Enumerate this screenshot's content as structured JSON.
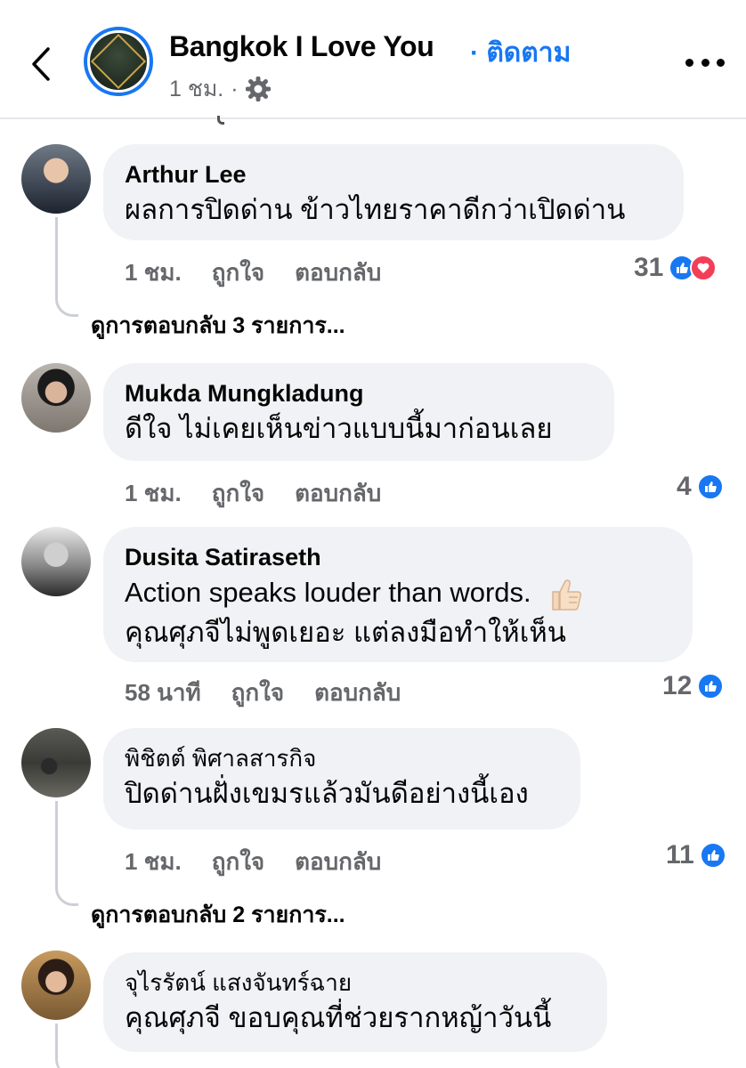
{
  "header": {
    "page_name": "Bangkok I Love You",
    "follow_label": "· ติดตาม",
    "time": "1 ชม.",
    "dot": "·"
  },
  "comments": [
    {
      "author": "Arthur Lee",
      "lines": [
        "ผลการปิดด่าน ข้าวไทยราคาดีกว่าเปิดด่าน"
      ],
      "time": "1 ชม.",
      "like": "ถูกใจ",
      "reply": "ตอบกลับ",
      "reaction_count": "31",
      "reactions": [
        "like",
        "love"
      ],
      "view_replies": "ดูการตอบกลับ 3 รายการ..."
    },
    {
      "author": "Mukda Mungkladung",
      "lines": [
        "ดีใจ  ไม่เคยเห็นข่าวแบบนี้มาก่อนเลย"
      ],
      "time": "1 ชม.",
      "like": "ถูกใจ",
      "reply": "ตอบกลับ",
      "reaction_count": "4",
      "reactions": [
        "like"
      ]
    },
    {
      "author": "Dusita Satiraseth",
      "lines": [
        "Action speaks louder than words.",
        "คุณศุภจีไม่พูดเยอะ แต่ลงมือทำให้เห็น"
      ],
      "time": "58 นาที",
      "like": "ถูกใจ",
      "reply": "ตอบกลับ",
      "reaction_count": "12",
      "reactions": [
        "like"
      ]
    },
    {
      "author": "พิชิตต์ พิศาลสารกิจ",
      "lines": [
        "ปิดด่านฝั่งเขมรแล้วมันดีอย่างนี้เอง"
      ],
      "time": "1 ชม.",
      "like": "ถูกใจ",
      "reply": "ตอบกลับ",
      "reaction_count": "11",
      "reactions": [
        "like"
      ],
      "view_replies": "ดูการตอบกลับ 2 รายการ..."
    },
    {
      "author": "จุไรรัตน์ แสงจันทร์ฉาย",
      "lines": [
        "คุณศุภจี  ขอบคุณที่ช่วยรากหญ้าวันนี้"
      ]
    }
  ],
  "colors": {
    "accent": "#1877f2",
    "love": "#f33e58",
    "bubble": "#f0f2f5",
    "muted": "#65676b"
  },
  "icons": [
    "back-chevron-icon",
    "globe-gear-icon",
    "more-dots-icon",
    "like-icon",
    "love-icon",
    "thumbs-up-emoji-icon"
  ]
}
